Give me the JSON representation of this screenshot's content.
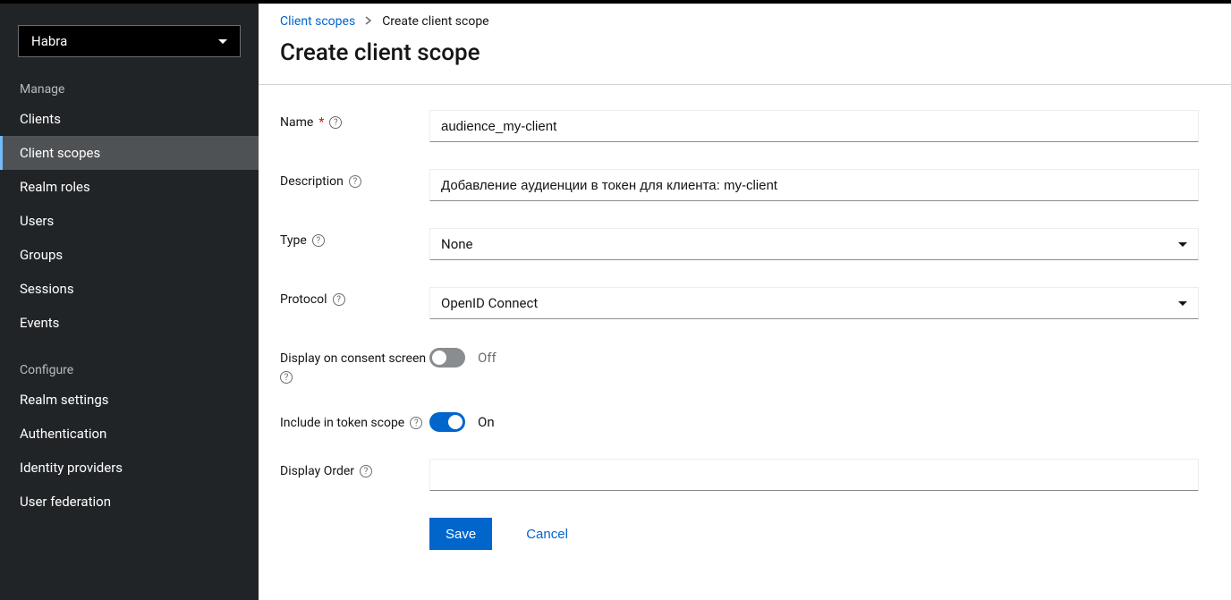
{
  "realm": {
    "selected": "Habra"
  },
  "sidebar": {
    "sections": {
      "manage": {
        "title": "Manage",
        "items": [
          {
            "label": "Clients"
          },
          {
            "label": "Client scopes",
            "active": true
          },
          {
            "label": "Realm roles"
          },
          {
            "label": "Users"
          },
          {
            "label": "Groups"
          },
          {
            "label": "Sessions"
          },
          {
            "label": "Events"
          }
        ]
      },
      "configure": {
        "title": "Configure",
        "items": [
          {
            "label": "Realm settings"
          },
          {
            "label": "Authentication"
          },
          {
            "label": "Identity providers"
          },
          {
            "label": "User federation"
          }
        ]
      }
    }
  },
  "breadcrumb": {
    "parent": "Client scopes",
    "current": "Create client scope"
  },
  "page": {
    "title": "Create client scope"
  },
  "form": {
    "name": {
      "label": "Name",
      "value": "audience_my-client",
      "required": true
    },
    "description": {
      "label": "Description",
      "value": "Добавление аудиенции в токен для клиента: my-client"
    },
    "type": {
      "label": "Type",
      "value": "None"
    },
    "protocol": {
      "label": "Protocol",
      "value": "OpenID Connect"
    },
    "display_consent": {
      "label": "Display on consent screen",
      "state": "Off",
      "on": false
    },
    "include_scope": {
      "label": "Include in token scope",
      "state": "On",
      "on": true
    },
    "display_order": {
      "label": "Display Order",
      "value": ""
    },
    "buttons": {
      "save": "Save",
      "cancel": "Cancel"
    }
  }
}
